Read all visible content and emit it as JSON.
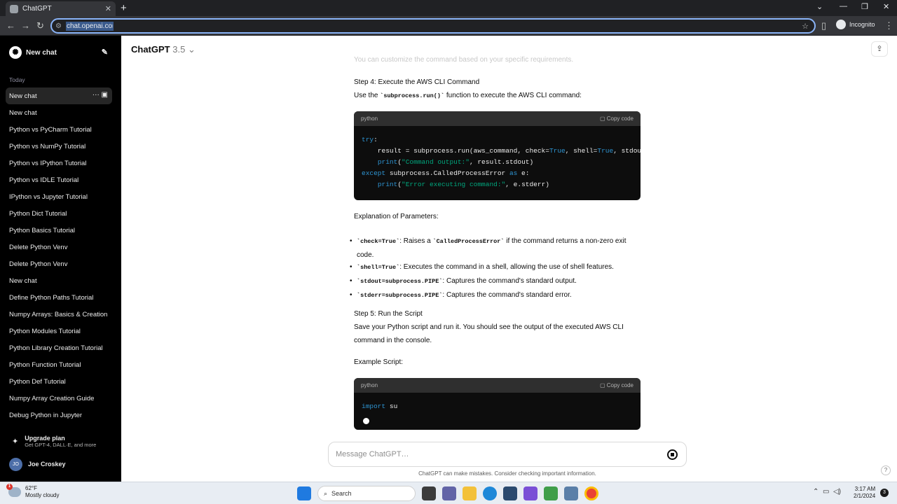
{
  "browser": {
    "tab_title": "ChatGPT",
    "url": "chat.openai.com",
    "profile_label": "Incognito"
  },
  "sidebar": {
    "new_chat_label": "New chat",
    "section_label": "Today",
    "chats": [
      "New chat",
      "New chat",
      "Python vs PyCharm Tutorial",
      "Python vs NumPy Tutorial",
      "Python vs IPython Tutorial",
      "Python vs IDLE Tutorial",
      "IPython vs Jupyter Tutorial",
      "Python Dict Tutorial",
      "Python Basics Tutorial",
      "Delete Python Venv",
      "Delete Python Venv",
      "New chat",
      "Define Python Paths Tutorial",
      "Numpy Arrays: Basics & Creation",
      "Python Modules Tutorial",
      "Python Library Creation Tutorial",
      "Python Function Tutorial",
      "Python Def Tutorial",
      "Numpy Array Creation Guide",
      "Debug Python in Jupyter"
    ],
    "upgrade_title": "Upgrade plan",
    "upgrade_subtitle": "Get GPT-4, DALL·E, and more",
    "user_initials": "JO",
    "user_name": "Joe Croskey"
  },
  "header": {
    "model_name": "ChatGPT",
    "model_version": "3.5"
  },
  "message": {
    "faded_line": "You can customize the command based on your specific requirements.",
    "step4_title": "Step 4: Execute the AWS CLI Command",
    "step4_pre": "Use the ",
    "step4_code": "`subprocess.run()`",
    "step4_post": " function to execute the AWS CLI command:",
    "code1_lang": "python",
    "copy_label": "Copy code",
    "explanation_title": "Explanation of Parameters:",
    "bullets": [
      {
        "code": "`check=True`",
        "pre": ": Raises a ",
        "code2": "`CalledProcessError`",
        "post": " if the command returns a non-zero exit code."
      },
      {
        "code": "`shell=True`",
        "pre": ": Executes the command in a shell, allowing the use of shell features.",
        "code2": "",
        "post": ""
      },
      {
        "code": "`stdout=subprocess.PIPE`",
        "pre": ": Captures the command's standard output.",
        "code2": "",
        "post": ""
      },
      {
        "code": "`stderr=subprocess.PIPE`",
        "pre": ": Captures the command's standard error.",
        "code2": "",
        "post": ""
      }
    ],
    "step5_title": "Step 5: Run the Script",
    "step5_text": "Save your Python script and run it. You should see the output of the executed AWS CLI command in the console.",
    "example_title": "Example Script:",
    "code2_lang": "python"
  },
  "composer": {
    "placeholder": "Message ChatGPT…",
    "disclaimer": "ChatGPT can make mistakes. Consider checking important information."
  },
  "taskbar": {
    "weather_temp": "62°F",
    "weather_desc": "Mostly cloudy",
    "weather_badge": "1",
    "search_label": "Search",
    "time": "3:17 AM",
    "date": "2/1/2024",
    "notif_count": "3"
  },
  "colors": {
    "sidebar_bg": "#000000",
    "code_bg": "#0d0d0d",
    "keyword": "#2e95d3",
    "string": "#00a67d",
    "address_border": "#8ab4f8"
  }
}
